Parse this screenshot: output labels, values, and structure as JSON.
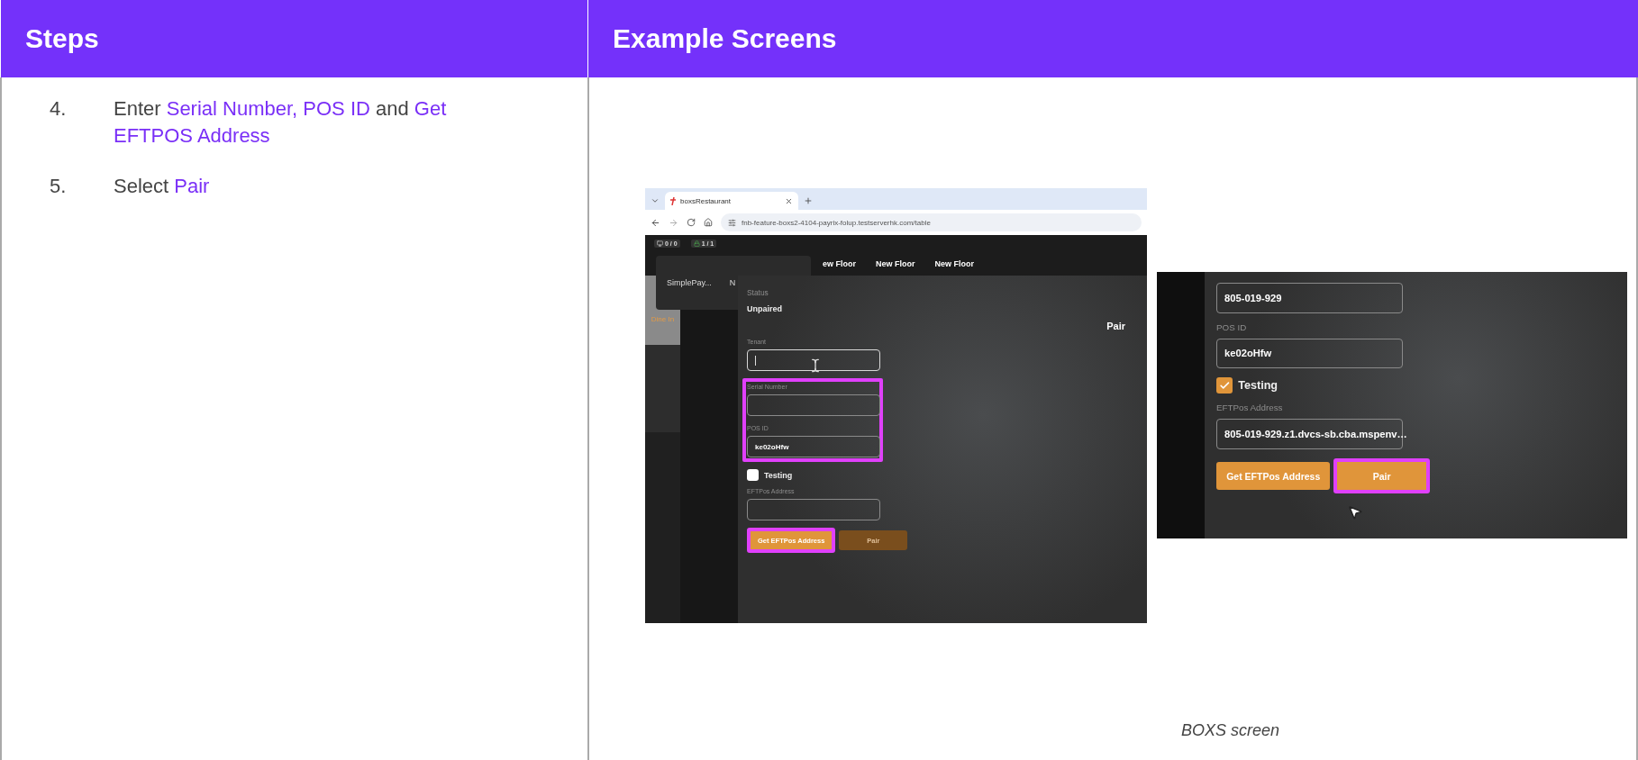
{
  "table": {
    "columns": [
      "Steps",
      "Example Screens"
    ]
  },
  "steps": [
    {
      "number": "4.",
      "segments": [
        {
          "text": "Enter ",
          "highlight": false
        },
        {
          "text": "Serial Number, POS ID",
          "highlight": true
        },
        {
          "text": " and ",
          "highlight": false
        },
        {
          "text": "Get EFTPOS Address",
          "highlight": true
        }
      ]
    },
    {
      "number": "5.",
      "segments": [
        {
          "text": "Select ",
          "highlight": false
        },
        {
          "text": "Pair",
          "highlight": true
        }
      ]
    }
  ],
  "screen_1": {
    "browser": {
      "tab_title": "boxsRestaurant",
      "url": "fnb-feature-boxs2-4104-payrix-folup.testserverhk.com/table"
    },
    "status": [
      "0 / 0",
      "1 / 1"
    ],
    "sidebar_label": "Dine In",
    "popup": [
      "SimplePay...",
      "N"
    ],
    "floor_tabs": [
      "ew Floor",
      "New Floor",
      "New Floor"
    ],
    "dialog": {
      "status_label": "Status",
      "status_value": "Unpaired",
      "title": "Pair",
      "rows": [
        {
          "kind": "field",
          "label": "Tenant",
          "focused": true,
          "highlighted": false
        },
        {
          "kind": "field",
          "label": "Serial Number",
          "focused": false,
          "highlighted": true
        },
        {
          "kind": "field",
          "label": "POS ID",
          "value": "ke02oHfw",
          "focused": false,
          "highlighted": true
        },
        {
          "kind": "checkbox",
          "label": "Testing",
          "checked": false
        },
        {
          "kind": "field",
          "label": "EFTPos Address",
          "focused": false,
          "highlighted": false
        },
        {
          "kind": "buttons",
          "buttons": [
            {
              "label": "Get EFTPos Address",
              "highlighted": true,
              "disabled": false
            },
            {
              "label": "Pair",
              "highlighted": false,
              "disabled": true
            }
          ]
        }
      ]
    }
  },
  "screen_2": {
    "dialog": {
      "rows": [
        {
          "kind": "field",
          "value": "805-019-929",
          "focused": false,
          "highlighted": false
        },
        {
          "kind": "field",
          "label": "POS ID",
          "value": "ke02oHfw",
          "focused": false,
          "highlighted": false
        },
        {
          "kind": "checkbox",
          "label": "Testing",
          "checked": true
        },
        {
          "kind": "field",
          "label": "EFTPos Address",
          "value": "805-019-929.z1.dvcs-sb.cba.mspenv…",
          "focused": false,
          "highlighted": false
        },
        {
          "kind": "buttons",
          "buttons": [
            {
              "label": "Get EFTPos Address",
              "highlighted": false,
              "disabled": false
            },
            {
              "label": "Pair",
              "highlighted": true,
              "disabled": false
            }
          ]
        }
      ]
    }
  },
  "caption": "BOXS screen"
}
